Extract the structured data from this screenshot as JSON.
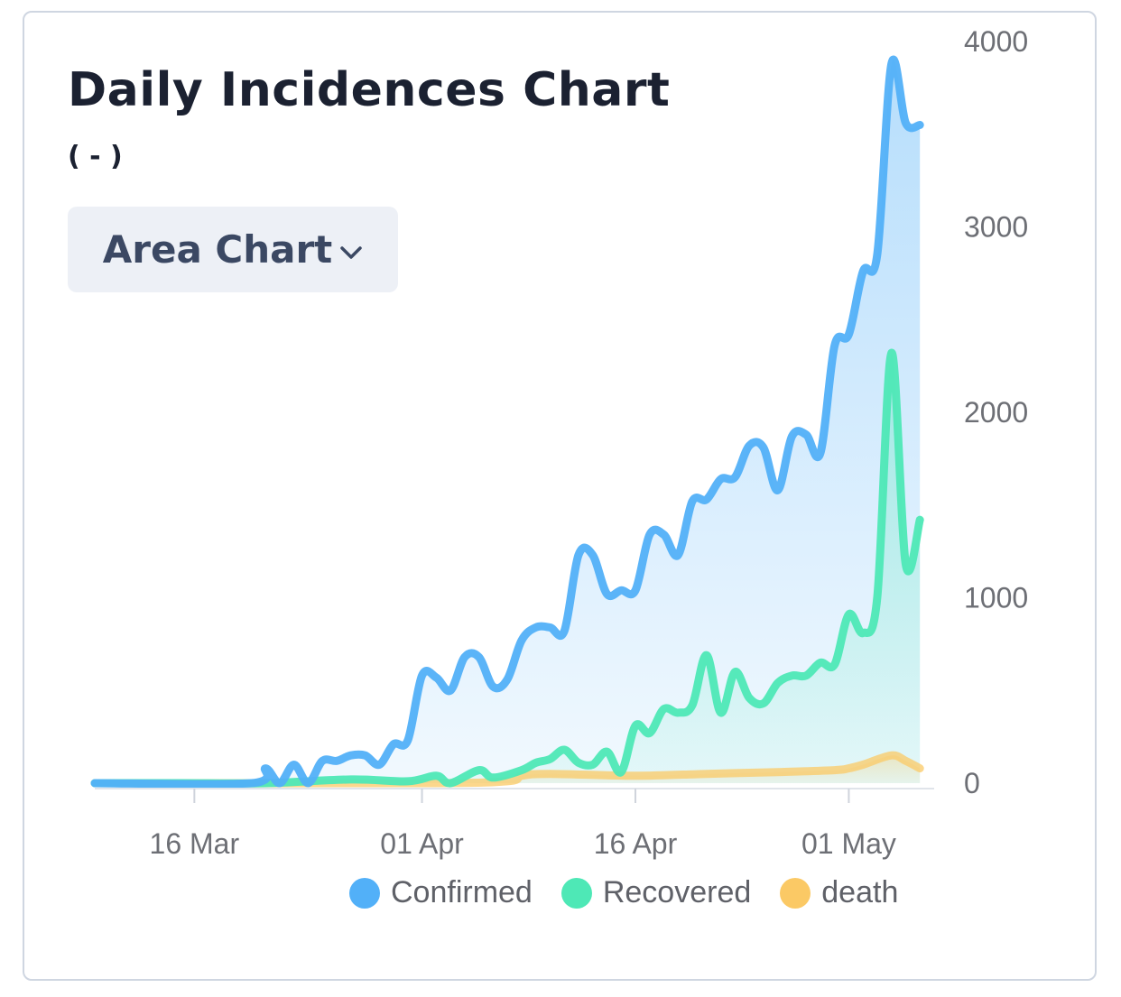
{
  "card": {
    "title": "Daily Incidences Chart",
    "subtitle": "( - )",
    "chart_type_button": "Area Chart",
    "chart_type_icon": "chevron-down-icon"
  },
  "chart_data": {
    "type": "area",
    "title": "Daily Incidences Chart",
    "subtitle": "( - )",
    "x_axis": {
      "type": "date",
      "range": [
        "2020-03-09",
        "2020-05-07"
      ],
      "ticks": [
        "16 Mar",
        "01 Apr",
        "16 Apr",
        "01 May"
      ],
      "tick_dates": [
        "2020-03-16",
        "2020-04-01",
        "2020-04-16",
        "2020-05-01"
      ]
    },
    "y_axis": {
      "position": "right",
      "ticks": [
        "0",
        "1000",
        "2000",
        "3000",
        "4000"
      ],
      "ylim": [
        0,
        4000
      ]
    },
    "grid": false,
    "legend_position": "bottom",
    "series": [
      {
        "name": "Confirmed",
        "color": "#52b0f8",
        "points": [
          [
            "2020-03-09",
            0
          ],
          [
            "2020-03-20",
            0
          ],
          [
            "2020-03-21",
            80
          ],
          [
            "2020-03-22",
            0
          ],
          [
            "2020-03-23",
            100
          ],
          [
            "2020-03-24",
            0
          ],
          [
            "2020-03-25",
            120
          ],
          [
            "2020-03-26",
            120
          ],
          [
            "2020-03-27",
            150
          ],
          [
            "2020-03-28",
            150
          ],
          [
            "2020-03-29",
            100
          ],
          [
            "2020-03-30",
            210
          ],
          [
            "2020-03-31",
            230
          ],
          [
            "2020-04-01",
            580
          ],
          [
            "2020-04-02",
            570
          ],
          [
            "2020-04-03",
            500
          ],
          [
            "2020-04-04",
            680
          ],
          [
            "2020-04-05",
            680
          ],
          [
            "2020-04-06",
            520
          ],
          [
            "2020-04-07",
            560
          ],
          [
            "2020-04-08",
            770
          ],
          [
            "2020-04-09",
            840
          ],
          [
            "2020-04-10",
            840
          ],
          [
            "2020-04-11",
            820
          ],
          [
            "2020-04-12",
            1230
          ],
          [
            "2020-04-13",
            1230
          ],
          [
            "2020-04-14",
            1020
          ],
          [
            "2020-04-15",
            1040
          ],
          [
            "2020-04-16",
            1040
          ],
          [
            "2020-04-17",
            1340
          ],
          [
            "2020-04-18",
            1340
          ],
          [
            "2020-04-19",
            1230
          ],
          [
            "2020-04-20",
            1520
          ],
          [
            "2020-04-21",
            1530
          ],
          [
            "2020-04-22",
            1640
          ],
          [
            "2020-04-23",
            1650
          ],
          [
            "2020-04-24",
            1820
          ],
          [
            "2020-04-25",
            1810
          ],
          [
            "2020-04-26",
            1580
          ],
          [
            "2020-04-27",
            1870
          ],
          [
            "2020-04-28",
            1880
          ],
          [
            "2020-04-29",
            1780
          ],
          [
            "2020-04-30",
            2360
          ],
          [
            "2020-05-01",
            2420
          ],
          [
            "2020-05-02",
            2760
          ],
          [
            "2020-05-03",
            2850
          ],
          [
            "2020-05-04",
            3880
          ],
          [
            "2020-05-05",
            3560
          ],
          [
            "2020-05-06",
            3550
          ]
        ]
      },
      {
        "name": "Recovered",
        "color": "#4ee8b6",
        "points": [
          [
            "2020-03-09",
            0
          ],
          [
            "2020-03-15",
            0
          ],
          [
            "2020-03-21",
            0
          ],
          [
            "2020-03-27",
            20
          ],
          [
            "2020-03-31",
            10
          ],
          [
            "2020-04-02",
            40
          ],
          [
            "2020-04-03",
            0
          ],
          [
            "2020-04-05",
            70
          ],
          [
            "2020-04-06",
            30
          ],
          [
            "2020-04-08",
            70
          ],
          [
            "2020-04-09",
            110
          ],
          [
            "2020-04-10",
            130
          ],
          [
            "2020-04-11",
            180
          ],
          [
            "2020-04-12",
            110
          ],
          [
            "2020-04-13",
            100
          ],
          [
            "2020-04-14",
            170
          ],
          [
            "2020-04-15",
            60
          ],
          [
            "2020-04-16",
            310
          ],
          [
            "2020-04-17",
            270
          ],
          [
            "2020-04-18",
            400
          ],
          [
            "2020-04-19",
            380
          ],
          [
            "2020-04-20",
            420
          ],
          [
            "2020-04-21",
            690
          ],
          [
            "2020-04-22",
            380
          ],
          [
            "2020-04-23",
            600
          ],
          [
            "2020-04-24",
            460
          ],
          [
            "2020-04-25",
            430
          ],
          [
            "2020-04-26",
            540
          ],
          [
            "2020-04-27",
            580
          ],
          [
            "2020-04-28",
            580
          ],
          [
            "2020-04-29",
            650
          ],
          [
            "2020-04-30",
            640
          ],
          [
            "2020-05-01",
            910
          ],
          [
            "2020-05-02",
            810
          ],
          [
            "2020-05-03",
            1000
          ],
          [
            "2020-05-04",
            2320
          ],
          [
            "2020-05-05",
            1180
          ],
          [
            "2020-05-06",
            1420
          ]
        ]
      },
      {
        "name": "death",
        "color": "#fbc965",
        "points": [
          [
            "2020-03-09",
            0
          ],
          [
            "2020-04-01",
            0
          ],
          [
            "2020-04-07",
            10
          ],
          [
            "2020-04-08",
            40
          ],
          [
            "2020-04-10",
            50
          ],
          [
            "2020-04-16",
            40
          ],
          [
            "2020-04-21",
            50
          ],
          [
            "2020-04-26",
            60
          ],
          [
            "2020-04-30",
            70
          ],
          [
            "2020-05-01",
            80
          ],
          [
            "2020-05-02",
            100
          ],
          [
            "2020-05-04",
            150
          ],
          [
            "2020-05-05",
            120
          ],
          [
            "2020-05-06",
            80
          ]
        ]
      }
    ]
  }
}
